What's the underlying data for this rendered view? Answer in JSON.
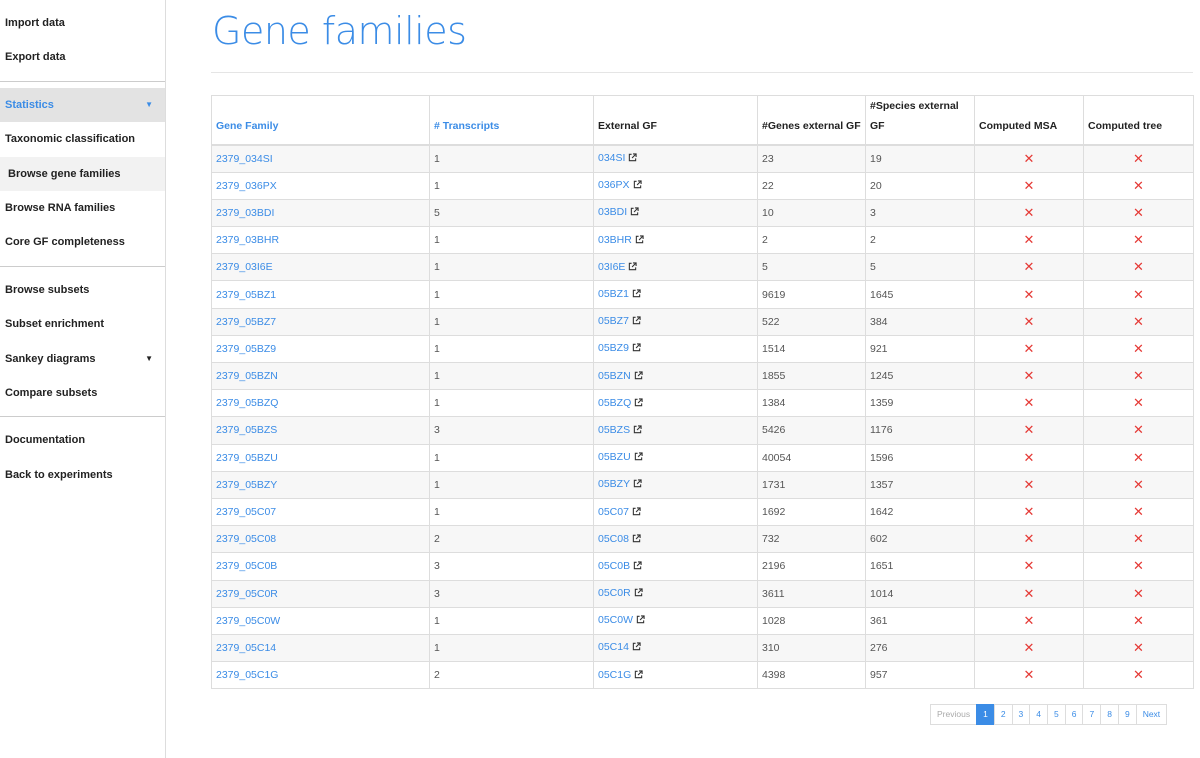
{
  "sidebar": {
    "groups": [
      [
        {
          "label": "Import data",
          "name": "nav-import-data"
        },
        {
          "label": "Export data",
          "name": "nav-export-data"
        }
      ],
      [
        {
          "label": "Statistics",
          "name": "nav-statistics",
          "state": "active",
          "caret": true
        },
        {
          "label": "Taxonomic classification",
          "name": "nav-taxonomic-classification"
        },
        {
          "label": "Browse gene families",
          "name": "nav-browse-gene-families",
          "state": "hover"
        },
        {
          "label": "Browse RNA families",
          "name": "nav-browse-rna-families"
        },
        {
          "label": "Core GF completeness",
          "name": "nav-core-gf-completeness"
        }
      ],
      [
        {
          "label": "Browse subsets",
          "name": "nav-browse-subsets"
        },
        {
          "label": "Subset enrichment",
          "name": "nav-subset-enrichment"
        },
        {
          "label": "Sankey diagrams",
          "name": "nav-sankey-diagrams",
          "caret": true
        },
        {
          "label": "Compare subsets",
          "name": "nav-compare-subsets"
        }
      ],
      [
        {
          "label": "Documentation",
          "name": "nav-documentation"
        },
        {
          "label": "Back to experiments",
          "name": "nav-back-to-experiments"
        }
      ]
    ]
  },
  "main": {
    "title": "Gene families"
  },
  "table": {
    "headers": [
      {
        "label": "Gene Family",
        "sortable": true
      },
      {
        "label": "# Transcripts",
        "sortable": true
      },
      {
        "label": "External GF",
        "sortable": false
      },
      {
        "label": "#Genes external GF",
        "sortable": false
      },
      {
        "label": "#Species external GF",
        "sortable": false
      },
      {
        "label": "Computed MSA",
        "sortable": false
      },
      {
        "label": "Computed tree",
        "sortable": false
      }
    ],
    "rows": [
      {
        "gf": "2379_034SI",
        "transcripts": "1",
        "ext": "034SI",
        "genes": "23",
        "species": "19"
      },
      {
        "gf": "2379_036PX",
        "transcripts": "1",
        "ext": "036PX",
        "genes": "22",
        "species": "20"
      },
      {
        "gf": "2379_03BDI",
        "transcripts": "5",
        "ext": "03BDI",
        "genes": "10",
        "species": "3"
      },
      {
        "gf": "2379_03BHR",
        "transcripts": "1",
        "ext": "03BHR",
        "genes": "2",
        "species": "2"
      },
      {
        "gf": "2379_03I6E",
        "transcripts": "1",
        "ext": "03I6E",
        "genes": "5",
        "species": "5"
      },
      {
        "gf": "2379_05BZ1",
        "transcripts": "1",
        "ext": "05BZ1",
        "genes": "9619",
        "species": "1645"
      },
      {
        "gf": "2379_05BZ7",
        "transcripts": "1",
        "ext": "05BZ7",
        "genes": "522",
        "species": "384"
      },
      {
        "gf": "2379_05BZ9",
        "transcripts": "1",
        "ext": "05BZ9",
        "genes": "1514",
        "species": "921"
      },
      {
        "gf": "2379_05BZN",
        "transcripts": "1",
        "ext": "05BZN",
        "genes": "1855",
        "species": "1245"
      },
      {
        "gf": "2379_05BZQ",
        "transcripts": "1",
        "ext": "05BZQ",
        "genes": "1384",
        "species": "1359"
      },
      {
        "gf": "2379_05BZS",
        "transcripts": "3",
        "ext": "05BZS",
        "genes": "5426",
        "species": "1176"
      },
      {
        "gf": "2379_05BZU",
        "transcripts": "1",
        "ext": "05BZU",
        "genes": "40054",
        "species": "1596"
      },
      {
        "gf": "2379_05BZY",
        "transcripts": "1",
        "ext": "05BZY",
        "genes": "1731",
        "species": "1357"
      },
      {
        "gf": "2379_05C07",
        "transcripts": "1",
        "ext": "05C07",
        "genes": "1692",
        "species": "1642"
      },
      {
        "gf": "2379_05C08",
        "transcripts": "2",
        "ext": "05C08",
        "genes": "732",
        "species": "602"
      },
      {
        "gf": "2379_05C0B",
        "transcripts": "3",
        "ext": "05C0B",
        "genes": "2196",
        "species": "1651"
      },
      {
        "gf": "2379_05C0R",
        "transcripts": "3",
        "ext": "05C0R",
        "genes": "3611",
        "species": "1014"
      },
      {
        "gf": "2379_05C0W",
        "transcripts": "1",
        "ext": "05C0W",
        "genes": "1028",
        "species": "361"
      },
      {
        "gf": "2379_05C14",
        "transcripts": "1",
        "ext": "05C14",
        "genes": "310",
        "species": "276"
      },
      {
        "gf": "2379_05C1G",
        "transcripts": "2",
        "ext": "05C1G",
        "genes": "4398",
        "species": "957"
      }
    ],
    "computed_msa_icon": "red-x-icon",
    "computed_tree_icon": "red-x-icon",
    "external_link_icon": "external-link-icon"
  },
  "pagination": {
    "previous": "Previous",
    "pages": [
      "1",
      "2",
      "3",
      "4",
      "5",
      "6",
      "7",
      "8",
      "9"
    ],
    "current": "1",
    "next": "Next"
  },
  "colors": {
    "accent": "#3b8ce6",
    "cross": "#e53935"
  }
}
